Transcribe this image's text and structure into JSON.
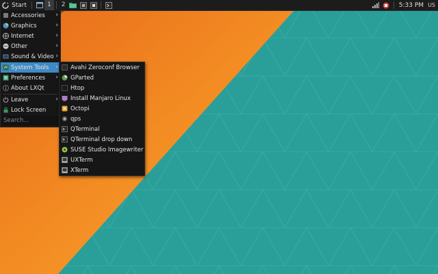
{
  "taskbar": {
    "start_label": "Start",
    "desktops": [
      "1",
      "2"
    ],
    "clock": "5:33 PM",
    "keyboard_layout": "US"
  },
  "main_menu": {
    "items": [
      {
        "label": "Accessories",
        "icon": "accessories-icon",
        "submenu": true
      },
      {
        "label": "Graphics",
        "icon": "graphics-icon",
        "submenu": true
      },
      {
        "label": "Internet",
        "icon": "internet-icon",
        "submenu": true
      },
      {
        "label": "Other",
        "icon": "other-icon",
        "submenu": true
      },
      {
        "label": "Sound & Video",
        "icon": "sound-video-icon",
        "submenu": true
      },
      {
        "label": "System Tools",
        "icon": "system-tools-icon",
        "submenu": true,
        "highlighted": true
      },
      {
        "label": "Preferences",
        "icon": "preferences-icon",
        "submenu": true
      },
      {
        "label": "About LXQt",
        "icon": "about-icon",
        "submenu": false
      },
      {
        "label": "Leave",
        "icon": "leave-icon",
        "submenu": true
      },
      {
        "label": "Lock Screen",
        "icon": "lock-icon",
        "submenu": false
      }
    ],
    "search_placeholder": "Search..."
  },
  "system_tools_menu": {
    "items": [
      {
        "label": "Avahi Zeroconf Browser",
        "icon": "avahi-icon"
      },
      {
        "label": "GParted",
        "icon": "gparted-icon"
      },
      {
        "label": "Htop",
        "icon": "htop-icon"
      },
      {
        "label": "Install Manjaro Linux",
        "icon": "installer-icon"
      },
      {
        "label": "Octopi",
        "icon": "octopi-icon"
      },
      {
        "label": "qps",
        "icon": "qps-icon"
      },
      {
        "label": "QTerminal",
        "icon": "terminal-icon"
      },
      {
        "label": "QTerminal drop down",
        "icon": "terminal-icon"
      },
      {
        "label": "SUSE Studio Imagewriter",
        "icon": "imagewriter-icon"
      },
      {
        "label": "UXTerm",
        "icon": "xterm-icon"
      },
      {
        "label": "XTerm",
        "icon": "xterm-icon"
      }
    ]
  },
  "colors": {
    "highlight": "#3f8ac4",
    "wallpaper_teal": "#2a9c98",
    "wallpaper_orange": "#f08a1e"
  }
}
